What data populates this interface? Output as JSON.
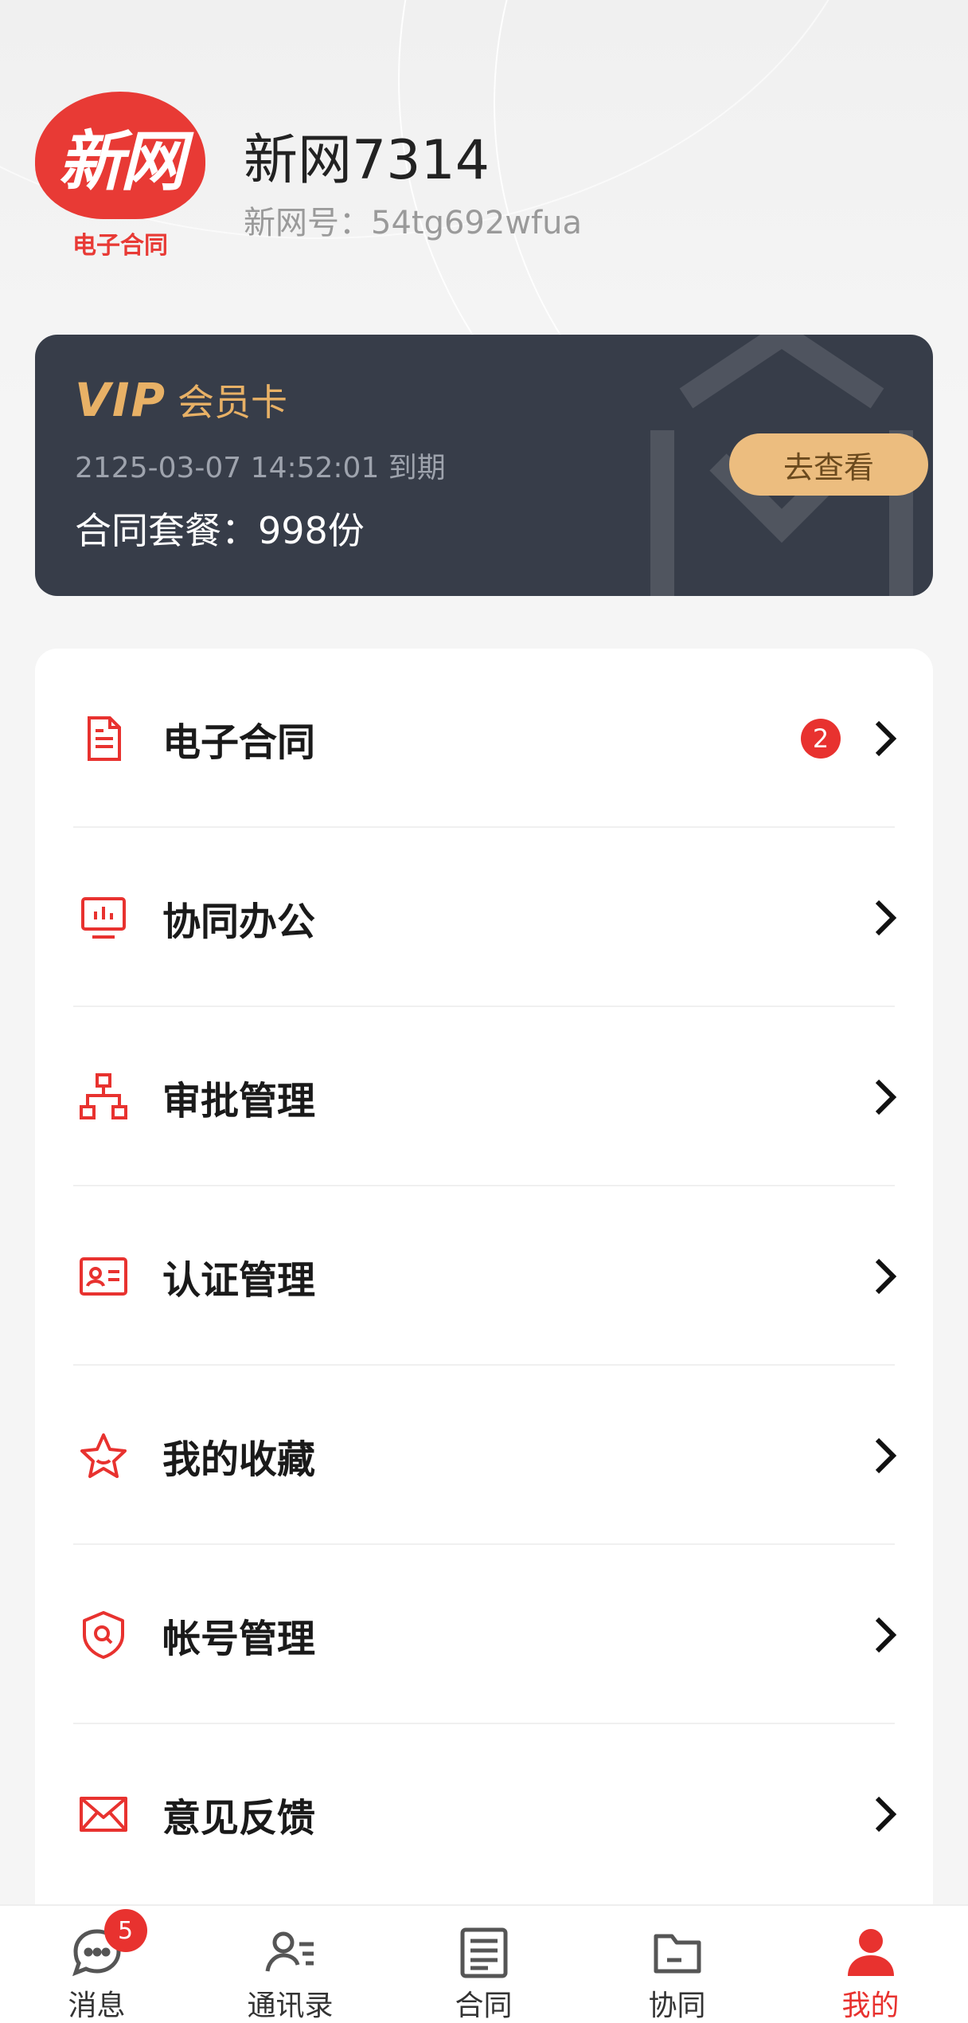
{
  "profile": {
    "logo_text": "新网",
    "logo_sub": "电子合同",
    "username": "新网7314",
    "user_id": "新网号：54tg692wfua"
  },
  "vip": {
    "badge": "VIP",
    "label": "会员卡",
    "expire": "2125-03-07 14:52:01 到期",
    "plan": "合同套餐：998份",
    "button": "去查看"
  },
  "menu": {
    "items": [
      {
        "label": "电子合同",
        "icon": "document-icon",
        "badge": "2"
      },
      {
        "label": "协同办公",
        "icon": "monitor-icon"
      },
      {
        "label": "审批管理",
        "icon": "org-chart-icon"
      },
      {
        "label": "认证管理",
        "icon": "id-card-icon"
      },
      {
        "label": "我的收藏",
        "icon": "star-icon"
      },
      {
        "label": "帐号管理",
        "icon": "shield-icon"
      },
      {
        "label": "意见反馈",
        "icon": "mail-icon"
      }
    ]
  },
  "tabbar": {
    "items": [
      {
        "label": "消息",
        "icon": "chat-icon",
        "badge": "5"
      },
      {
        "label": "通讯录",
        "icon": "contacts-icon"
      },
      {
        "label": "合同",
        "icon": "contract-icon"
      },
      {
        "label": "协同",
        "icon": "folder-icon"
      },
      {
        "label": "我的",
        "icon": "person-icon"
      }
    ],
    "active": "我的"
  },
  "colors": {
    "accent": "#e8322f",
    "vip_bg": "#373d49",
    "vip_gold": "#e8b166"
  }
}
